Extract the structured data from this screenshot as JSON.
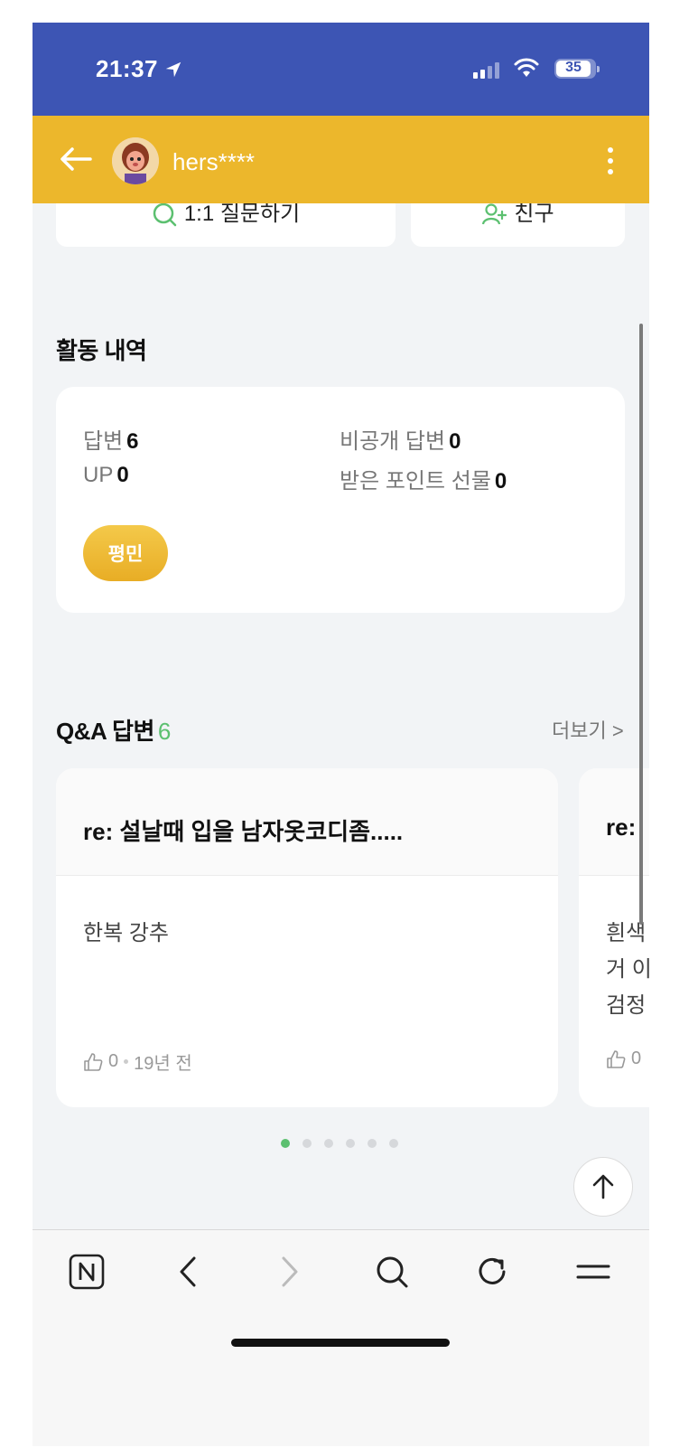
{
  "status_bar": {
    "time": "21:37",
    "battery": "35"
  },
  "header": {
    "username": "hers****"
  },
  "top_actions": {
    "ask_label": "1:1 질문하기",
    "friend_label": "친구"
  },
  "activity": {
    "title": "활동 내역",
    "stats": [
      {
        "label": "답변",
        "value": "6"
      },
      {
        "label": "비공개 답변",
        "value": "0"
      },
      {
        "label": "UP",
        "value": "0"
      },
      {
        "label": "받은 포인트 선물",
        "value": "0"
      }
    ],
    "rank": "평민"
  },
  "qa": {
    "title": "Q&A 답변",
    "count": "6",
    "more_label": "더보기 >",
    "cards": [
      {
        "question": "re: 설날때 입을 남자옷코디좀.....",
        "answer": "한복 강추",
        "likes": "0",
        "date": "19년 전"
      },
      {
        "question": "re:",
        "answer": "흰색\n거 이\n검정",
        "likes": "0"
      }
    ],
    "pages": 6,
    "active_page": 0
  },
  "colors": {
    "status_bar": "#3d55b4",
    "header": "#ecb72c",
    "accent_green": "#5cc070",
    "badge": "#ecb72c"
  },
  "toolbar": {
    "icons": [
      "naver-icon",
      "back-icon",
      "forward-icon",
      "search-icon",
      "reload-icon",
      "menu-icon"
    ]
  }
}
